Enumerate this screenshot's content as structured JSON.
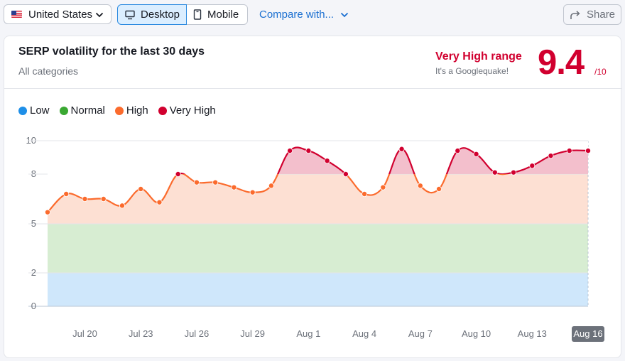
{
  "toolbar": {
    "country": "United States",
    "device_desktop": "Desktop",
    "device_mobile": "Mobile",
    "compare": "Compare with...",
    "share": "Share"
  },
  "card": {
    "title": "SERP volatility for the last 30 days",
    "subtitle": "All categories",
    "range_label": "Very High range",
    "range_sub": "It's a Googlequake!",
    "score": "9.4",
    "score_max": "/10"
  },
  "colors": {
    "low": "#1e8fe8",
    "normal": "#3aa832",
    "high": "#fb6b2d",
    "very_high": "#d1002f"
  },
  "chart_data": {
    "type": "area",
    "x": [
      "Jul 18",
      "Jul 19",
      "Jul 20",
      "Jul 21",
      "Jul 22",
      "Jul 23",
      "Jul 24",
      "Jul 25",
      "Jul 26",
      "Jul 27",
      "Jul 28",
      "Jul 29",
      "Jul 30",
      "Jul 31",
      "Aug 1",
      "Aug 2",
      "Aug 3",
      "Aug 4",
      "Aug 5",
      "Aug 6",
      "Aug 7",
      "Aug 8",
      "Aug 9",
      "Aug 10",
      "Aug 11",
      "Aug 12",
      "Aug 13",
      "Aug 14",
      "Aug 15",
      "Aug 16"
    ],
    "series": [
      {
        "values": [
          5.7,
          6.8,
          6.5,
          6.5,
          6.1,
          7.1,
          6.3,
          8.0,
          7.5,
          7.5,
          7.2,
          6.9,
          7.3,
          9.4,
          9.4,
          8.8,
          8.0,
          6.8,
          7.2,
          9.5,
          7.3,
          7.1,
          9.4,
          9.2,
          8.1,
          8.1,
          8.5,
          9.1,
          9.4,
          9.4
        ]
      }
    ],
    "ranges": [
      {
        "label": "Low",
        "from": 0,
        "to": 2,
        "color": "#cfe7fb"
      },
      {
        "label": "Normal",
        "from": 2,
        "to": 5,
        "color": "#d7edd2"
      },
      {
        "label": "High",
        "from": 5,
        "to": 8,
        "color": "#fde0d3"
      },
      {
        "label": "Very High",
        "from": 8,
        "to": 10,
        "color": "#f5d2db"
      }
    ],
    "legend": [
      "Low",
      "Normal",
      "High",
      "Very High"
    ],
    "y_ticks": [
      0,
      2,
      5,
      8,
      10
    ],
    "x_ticks": [
      "Jul 20",
      "Jul 23",
      "Jul 26",
      "Jul 29",
      "Aug 1",
      "Aug 4",
      "Aug 7",
      "Aug 10",
      "Aug 13",
      "Aug 16"
    ],
    "highlighted_tick": "Aug 16",
    "ylim": [
      0,
      10
    ],
    "legend_position": "top-left",
    "grid": true
  }
}
